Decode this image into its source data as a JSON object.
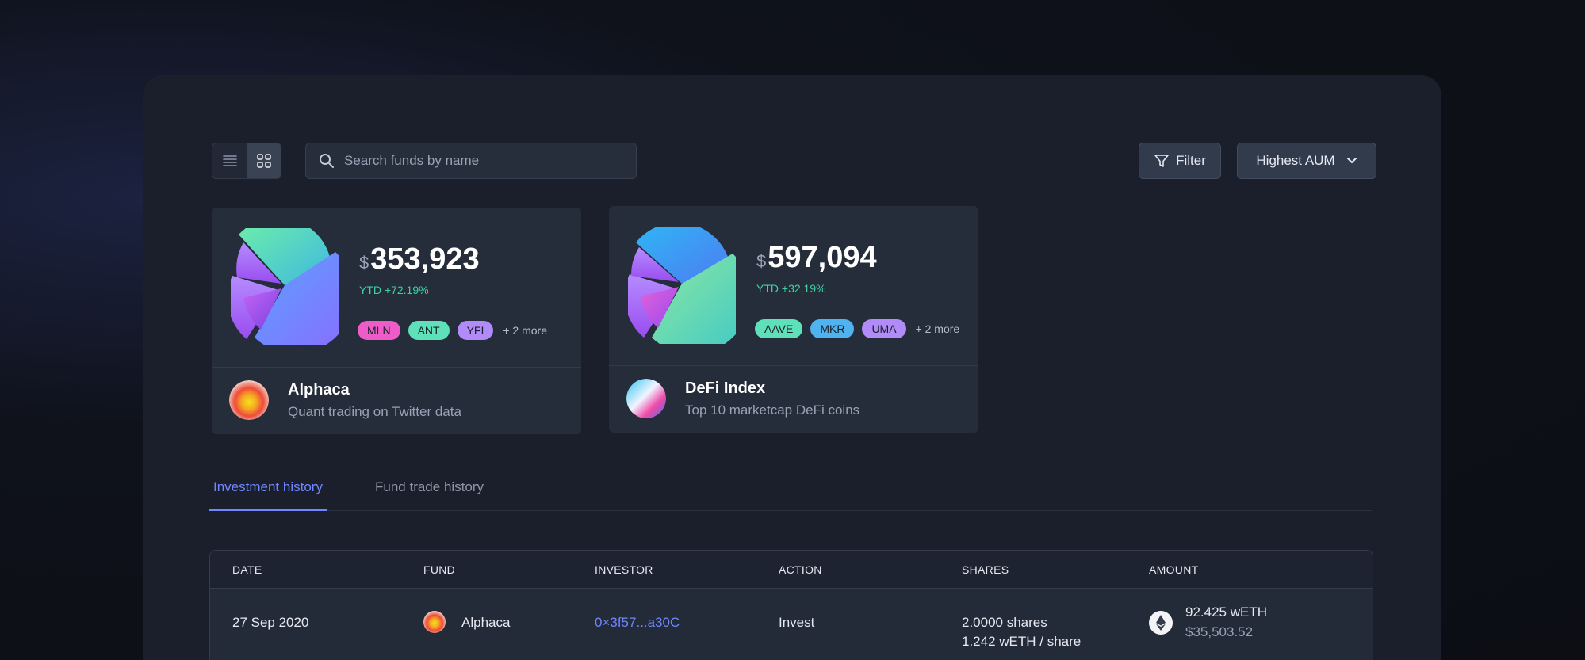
{
  "toolbar": {
    "search_placeholder": "Search funds by name",
    "filter_label": "Filter",
    "sort_label": "Highest AUM"
  },
  "cards": [
    {
      "currency": "$",
      "value": "353,923",
      "ytd": "YTD +72.19%",
      "tags": [
        "MLN",
        "ANT",
        "YFI"
      ],
      "tag_colors": [
        "#ee5cc8",
        "#5ee0b8",
        "#b18bf7"
      ],
      "more": "+ 2 more",
      "name": "Alphaca",
      "description": "Quant trading on Twitter data"
    },
    {
      "currency": "$",
      "value": "597,094",
      "ytd": "YTD +32.19%",
      "tags": [
        "AAVE",
        "MKR",
        "UMA"
      ],
      "tag_colors": [
        "#5ee0b8",
        "#4fb3f0",
        "#b18bf7"
      ],
      "more": "+ 2 more",
      "name": "DeFi Index",
      "description": "Top 10 marketcap DeFi coins"
    }
  ],
  "tabs": [
    {
      "label": "Investment history",
      "active": true
    },
    {
      "label": "Fund trade history",
      "active": false
    }
  ],
  "table": {
    "headers": [
      "DATE",
      "FUND",
      "INVESTOR",
      "ACTION",
      "SHARES",
      "AMOUNT"
    ],
    "rows": [
      {
        "date": "27 Sep 2020",
        "fund": "Alphaca",
        "investor": "0×3f57...a30C",
        "action": "Invest",
        "shares": "2.0000 shares",
        "per_share": "1.242 wETH / share",
        "amount": "92.425 wETH",
        "amount_usd": "$35,503.52"
      }
    ]
  },
  "colors": {
    "accent": "#6f86ff",
    "positive": "#3ed3a0",
    "panel": "#1a1f2b",
    "card": "#252c3a"
  }
}
